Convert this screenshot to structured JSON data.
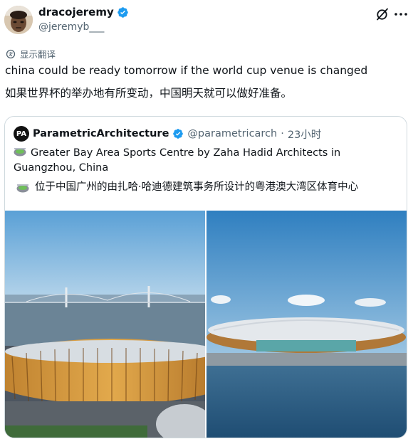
{
  "author": {
    "display_name": "dracojeremy",
    "handle": "@jeremyb___"
  },
  "translate_label": "显示翻译",
  "tweet": {
    "text_en": "china could be ready tomorrow if the world cup venue is changed",
    "text_zh": "如果世界杯的举办地有所变动，中国明天就可以做好准备。"
  },
  "quote": {
    "avatar_text": "PA",
    "display_name": "ParametricArchitecture",
    "handle": "@parametricarch",
    "separator": "·",
    "time": "23小时",
    "text_en": "Greater Bay Area Sports Centre by Zaha Hadid Architects in Guangzhou, China",
    "text_zh": "位于中国广州的由扎哈·哈迪德建筑事务所设计的粤港澳大湾区体育中心"
  },
  "colors": {
    "verified": "#1d9bf0",
    "secondary_text": "#536471",
    "border": "#cfd9de"
  },
  "icons": [
    "verified-badge-icon",
    "grok-icon",
    "more-icon",
    "translate-icon",
    "stadium-emoji-icon"
  ]
}
